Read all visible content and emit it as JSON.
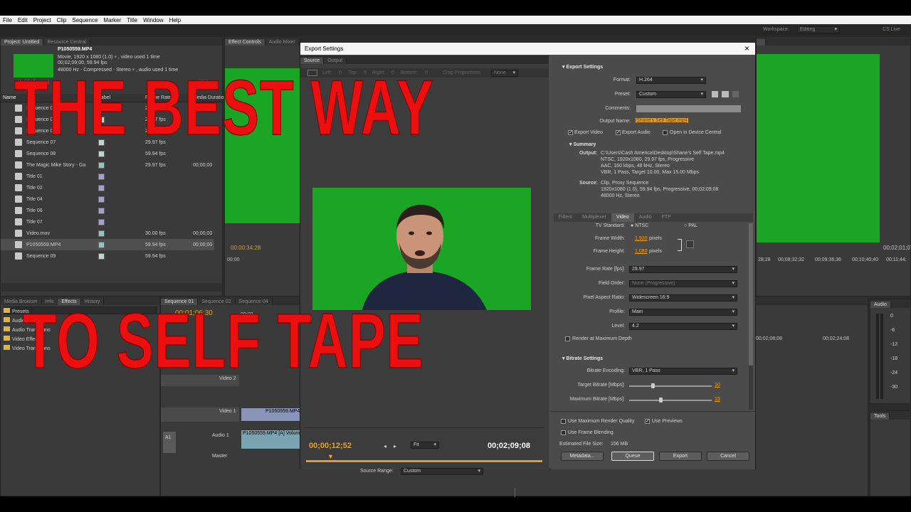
{
  "menu": [
    "File",
    "Edit",
    "Project",
    "Clip",
    "Sequence",
    "Marker",
    "Title",
    "Window",
    "Help"
  ],
  "workspace": {
    "label": "Workspace:",
    "value": "Editing",
    "cs_live": "CS Live"
  },
  "project": {
    "tabs": [
      "Project: Untitled",
      "Resource Central"
    ],
    "clip_name": "P1050559.MP4",
    "clip_info1": "Movie, 1920 x 1080 (1.0)",
    "clip_info1b": ", video used 1 time",
    "clip_info2": "00;02;09;00, 59.94 fps",
    "clip_info3": "48000 Hz - Compressed - Stereo",
    "clip_info3b": ", audio used 1 time",
    "proj_file": "Untitled.prproj",
    "items_count": "22 Items",
    "columns": [
      "Name",
      "Label",
      "Frame Rate",
      "Media Duration"
    ],
    "rows": [
      {
        "name": "Sequence 01",
        "fps": "29.97 fps",
        "dur": ""
      },
      {
        "name": "Sequence 02",
        "fps": "29.97 fps",
        "dur": ""
      },
      {
        "name": "Sequence 04",
        "fps": "29.97 fps",
        "dur": ""
      },
      {
        "name": "Sequence 07",
        "fps": "29.97 fps",
        "dur": ""
      },
      {
        "name": "Sequence 08",
        "fps": "59.94 fps",
        "dur": ""
      },
      {
        "name": "The Magic Mike Story - Ga",
        "fps": "29.97 fps",
        "dur": "00;00;00"
      },
      {
        "name": "Title 01",
        "fps": "",
        "dur": ""
      },
      {
        "name": "Title 02",
        "fps": "",
        "dur": ""
      },
      {
        "name": "Title 04",
        "fps": "",
        "dur": ""
      },
      {
        "name": "Title 06",
        "fps": "",
        "dur": ""
      },
      {
        "name": "Title 07",
        "fps": "",
        "dur": ""
      },
      {
        "name": "Video.mov",
        "fps": "30.00 fps",
        "dur": "00;00;00"
      },
      {
        "name": "P1050559.MP4",
        "fps": "59.94 fps",
        "dur": "00;00;00"
      },
      {
        "name": "Sequence 09",
        "fps": "59.94 fps",
        "dur": ""
      }
    ]
  },
  "source_monitor": {
    "tabs": [
      "Effect Controls",
      "Audio Mixer"
    ],
    "timecode": "00:00:34:28",
    "ruler": "00;00"
  },
  "program_monitor": {
    "timecode": "00;02;01;07",
    "ruler": [
      "00;08;32;32",
      "00;09;36;36",
      "00;10;40;40",
      "00;11;44;"
    ],
    "ruler0": "28;28"
  },
  "lower_left": {
    "tabs": [
      "Media Browser",
      "Info",
      "Effects",
      "History"
    ],
    "folders": [
      "Presets",
      "Audio Effects",
      "Audio Transitions",
      "Video Effects",
      "Video Transitions"
    ]
  },
  "timeline": {
    "tabs": [
      "Sequence 01",
      "Sequence 02",
      "Sequence 04"
    ],
    "timecode": "00;01;06;30",
    "ruler": "00;00",
    "tracks": [
      "Video 2",
      "Video 1",
      "Audio 1",
      "Master"
    ],
    "clip_v": "P1050559.MP4 [V]",
    "clip_a": "P1050559.MP4 [A] Volume",
    "ruler_right": [
      "00;02;08;08",
      "00;02;24;08"
    ]
  },
  "audio_meter": {
    "tab": "Audio",
    "levels": [
      "0",
      "-6",
      "-12",
      "-18",
      "-24",
      "-30"
    ]
  },
  "tools": {
    "tab": "Tools"
  },
  "dialog": {
    "title": "Export Settings",
    "close": "×",
    "tabs": [
      "Source",
      "Output"
    ],
    "crop": {
      "left": "Left:",
      "left_v": "0",
      "top": "Top:",
      "top_v": "0",
      "right": "Right:",
      "right_v": "0",
      "bottom": "Bottom:",
      "bottom_v": "0",
      "prop": "Crop Proportions:",
      "prop_v": "None"
    },
    "timecode_current": "00;00;12;52",
    "fit": "Fit",
    "timecode_end": "00;02;09;08",
    "source_range_label": "Source Range:",
    "source_range": "Custom",
    "export_settings": {
      "header": "Export Settings",
      "format_label": "Format:",
      "format": "H.264",
      "preset_label": "Preset:",
      "preset": "Custom",
      "comments_label": "Comments:",
      "output_name_label": "Output Name:",
      "output_name": "Shane's Self Tape.mp4",
      "export_video": "Export Video",
      "export_audio": "Export Audio",
      "open_central": "Open in Device Central"
    },
    "summary": {
      "header": "Summary",
      "output_label": "Output:",
      "output_lines": [
        "C:\\Users\\Cash America\\Desktop\\Shane's Self Tape.mp4",
        "NTSC, 1920x1080, 29.97 fps, Progressive",
        "AAC, 160 kbps, 48 kHz, Stereo",
        "VBR, 1 Pass, Target 10.00, Max 15.00 Mbps"
      ],
      "source_label": "Source:",
      "source_lines": [
        "Clip, Proxy Sequence",
        "1920x1080 (1.0), 59.94 fps, Progressive, 00;02;09;08",
        "48000 Hz, Stereo"
      ]
    },
    "settings_tabs": [
      "Filters",
      "Multiplexer",
      "Video",
      "Audio",
      "FTP"
    ],
    "video": {
      "tv_standard_label": "TV Standard:",
      "ntsc": "NTSC",
      "pal": "PAL",
      "frame_width_label": "Frame Width:",
      "frame_width": "1,920",
      "frame_height_label": "Frame Height:",
      "frame_height": "1,080",
      "pixels": "pixels",
      "frame_rate_label": "Frame Rate [fps]:",
      "frame_rate": "29.97",
      "field_order_label": "Field Order:",
      "field_order": "None (Progressive)",
      "par_label": "Pixel Aspect Ratio:",
      "par": "Widescreen 16:9",
      "profile_label": "Profile:",
      "profile": "Main",
      "level_label": "Level:",
      "level": "4.2",
      "render_max": "Render at Maximum Depth"
    },
    "bitrate": {
      "header": "Bitrate Settings",
      "encoding_label": "Bitrate Encoding:",
      "encoding": "VBR, 1 Pass",
      "target_label": "Target Bitrate [Mbps]:",
      "target": "10",
      "target_pct": 0.28,
      "max_label": "Maximum Bitrate [Mbps]:",
      "max": "15",
      "max_pct": 0.38
    },
    "bottom": {
      "max_render": "Use Maximum Render Quality",
      "previews": "Use Previews",
      "blending": "Use Frame Blending",
      "filesize_label": "Estimated File Size:",
      "filesize": "156 MB",
      "metadata": "Metadata...",
      "queue": "Queue",
      "export": "Export",
      "cancel": "Cancel"
    }
  },
  "overlay": {
    "line1": "THE BEST WAY",
    "line2": "TO SELF TAPE",
    "color": "#ec0f0f"
  }
}
